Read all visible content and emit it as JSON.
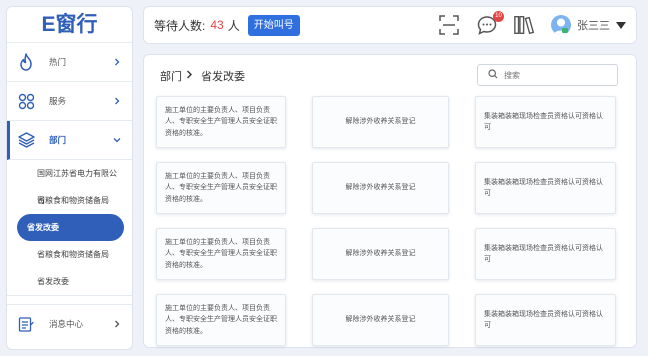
{
  "app": {
    "logo": "E窗行"
  },
  "sidebar": {
    "items": [
      {
        "label": "热门",
        "icon": "flame-icon"
      },
      {
        "label": "服务",
        "icon": "services-icon"
      },
      {
        "label": "部门",
        "icon": "layers-icon",
        "expanded": true
      }
    ],
    "sub_items": [
      {
        "label": "国网江苏省电力有限公司"
      },
      {
        "label": "省粮食和物资储备局"
      },
      {
        "label": "省发改委",
        "selected": true
      },
      {
        "label": "省粮食和物资储备局"
      },
      {
        "label": "省发改委"
      }
    ],
    "bottom": {
      "label": "消息中心",
      "icon": "message-center-icon"
    }
  },
  "header": {
    "wait_label": "等待人数:",
    "wait_count": "43",
    "wait_unit": "人",
    "call_button": "开始叫号",
    "notification_count": "10",
    "user_name": "张三三"
  },
  "main": {
    "breadcrumb": {
      "parent": "部门",
      "current": "省发改委"
    },
    "search": {
      "placeholder": "搜索"
    },
    "cards": [
      {
        "text": "施工单位的主要负责人、项目负责人、专职安全生产管理人员安全证职资格的核准。"
      },
      {
        "text": "解除涉外收养关系登记"
      },
      {
        "text": "集装箱装箱现场检查员资格认可资格认可"
      },
      {
        "text": "施工单位的主要负责人、项目负责人、专职安全生产管理人员安全证职资格的核准。"
      },
      {
        "text": "解除涉外收养关系登记"
      },
      {
        "text": "集装箱装箱现场检查员资格认可资格认可"
      },
      {
        "text": "施工单位的主要负责人、项目负责人、专职安全生产管理人员安全证职资格的核准。"
      },
      {
        "text": "解除涉外收养关系登记"
      },
      {
        "text": "集装箱装箱现场检查员资格认可资格认可"
      },
      {
        "text": "施工单位的主要负责人、项目负责人、专职安全生产管理人员安全证职资格的核准。"
      },
      {
        "text": "解除涉外收养关系登记"
      },
      {
        "text": "集装箱装箱现场检查员资格认可资格认可"
      }
    ]
  },
  "colors": {
    "accent": "#2f5fb8",
    "button": "#2f6fe0",
    "count": "#e14646"
  }
}
